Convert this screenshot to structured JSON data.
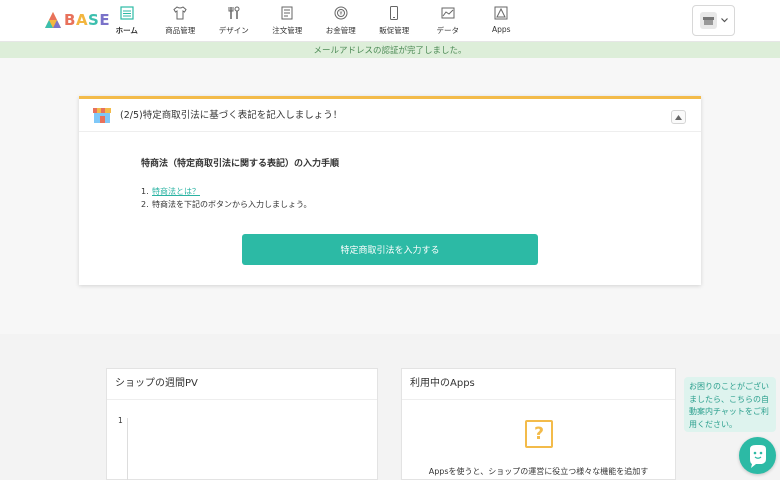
{
  "header": {
    "logo_text": "BASE",
    "nav": [
      {
        "label": "ホーム",
        "icon": "home-icon",
        "active": true
      },
      {
        "label": "商品管理",
        "icon": "tshirt-icon"
      },
      {
        "label": "デザイン",
        "icon": "tools-icon"
      },
      {
        "label": "注文管理",
        "icon": "document-icon"
      },
      {
        "label": "お金管理",
        "icon": "coin-icon"
      },
      {
        "label": "販促管理",
        "icon": "phone-icon"
      },
      {
        "label": "データ",
        "icon": "chart-icon"
      },
      {
        "label": "Apps",
        "icon": "apps-icon"
      }
    ]
  },
  "notice": {
    "text": "メールアドレスの認証が完了しました。"
  },
  "task_card": {
    "title": "(2/5)特定商取引法に基づく表記を記入しましょう！",
    "subtitle": "特商法（特定商取引法に関する表記）の入力手順",
    "steps": [
      {
        "num": "1.",
        "text": "特商法とは？",
        "link": true
      },
      {
        "num": "2.",
        "text": "特商法を下記のボタンから入力しましょう。",
        "link": false
      }
    ],
    "button_label": "特定商取引法を入力する"
  },
  "panels": {
    "weekly_pv": {
      "title": "ショップの週間PV",
      "y_tick": "1"
    },
    "apps": {
      "title": "利用中のApps",
      "icon_glyph": "?",
      "text": "Appsを使うと、ショップの運営に役立つ様々な機能を追加す"
    }
  },
  "help": {
    "text": "お困りのことがございましたら、こちらの自動案内チャットをご利用ください。"
  },
  "colors": {
    "accent": "#2cbaa5",
    "card_top": "#f3bb4a",
    "notice_bg": "#ddeed9",
    "notice_text": "#4c8a55"
  }
}
